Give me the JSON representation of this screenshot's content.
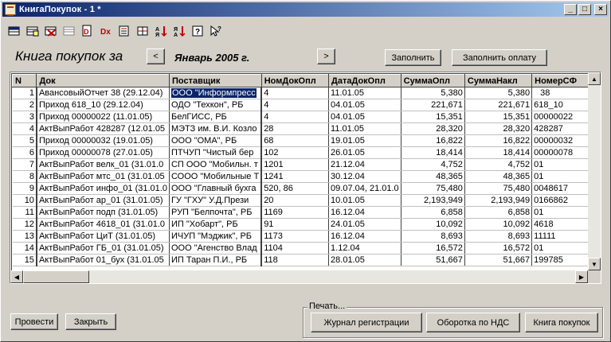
{
  "window": {
    "title": "КнигаПокупок - 1 *",
    "controls": [
      "_",
      "□",
      "×"
    ]
  },
  "toolbar": {
    "icons": [
      "new-row-icon",
      "copy-row-icon",
      "delete-row-icon",
      "edit-row-icon",
      "add-doc-icon",
      "remove-doc-icon",
      "report-icon",
      "table-icon",
      "sort-asc-icon",
      "sort-desc-icon",
      "help-icon",
      "cursor-help-icon"
    ]
  },
  "header": {
    "title": "Книга покупок за",
    "period": "Январь 2005 г.",
    "prev_label": "<",
    "next_label": ">",
    "fill_label": "Заполнить",
    "fill_payment_label": "Заполнить оплату"
  },
  "table": {
    "columns": [
      "N",
      "Док",
      "Поставщик",
      "НомДокОпл",
      "ДатаДокОпл",
      "СуммаОпл",
      "СуммаНакл",
      "НомерСФ"
    ],
    "rows": [
      [
        "1",
        "АвансовыйОтчет 38 (29.12.04)",
        "ООО \"Информпресс",
        "4",
        "11.01.05",
        "5,380",
        "5,380",
        "38"
      ],
      [
        "2",
        "Приход 618_10 (29.12.04)",
        "ОДО \"Техкон\", РБ",
        "4",
        "04.01.05",
        "221,671",
        "221,671",
        "618_10"
      ],
      [
        "3",
        "Приход 00000022 (11.01.05)",
        "БелГИСС, РБ",
        "4",
        "04.01.05",
        "15,351",
        "15,351",
        "00000022"
      ],
      [
        "4",
        "АктВыпРабот 428287 (12.01.05",
        "МЭТЗ им. В.И. Козло",
        "28",
        "11.01.05",
        "28,320",
        "28,320",
        "428287"
      ],
      [
        "5",
        "Приход 00000032 (19.01.05)",
        "ООО \"ОМА\", РБ",
        "68",
        "19.01.05",
        "16,822",
        "16,822",
        "00000032"
      ],
      [
        "6",
        "Приход 00000078 (27.01.05)",
        "ПТЧУП \"Чистый бер",
        "102",
        "26.01.05",
        "18,414",
        "18,414",
        "00000078"
      ],
      [
        "7",
        "АктВыпРабот велк_01 (31.01.0",
        "СП ООО \"Мобильн. т",
        "1201",
        "21.12.04",
        "4,752",
        "4,752",
        "01"
      ],
      [
        "8",
        "АктВыпРабот мтс_01 (31.01.05",
        "СООО \"Мобильные Т",
        "1241",
        "30.12.04",
        "48,365",
        "48,365",
        "01"
      ],
      [
        "9",
        "АктВыпРабот инфо_01 (31.01.0",
        "ООО \"Главный бухга",
        "520, 86",
        "09.07.04, 21.01.0",
        "75,480",
        "75,480",
        "0048617"
      ],
      [
        "10",
        "АктВыпРабот ар_01 (31.01.05)",
        "ГУ \"ГХУ\" У.Д.Прези",
        "20",
        "10.01.05",
        "2,193,949",
        "2,193,949",
        "0166862"
      ],
      [
        "11",
        "АктВыпРабот подп (31.01.05)",
        "РУП \"Белпочта\", РБ",
        "1169",
        "16.12.04",
        "6,858",
        "6,858",
        "01"
      ],
      [
        "12",
        "АктВыпРабот 4618_01 (31.01.0",
        "ИП \"Хобарт\", РБ",
        "91",
        "24.01.05",
        "10,092",
        "10,092",
        "4618"
      ],
      [
        "13",
        "АктВыпРабот ЦиТ (31.01.05)",
        "ИЧУП \"Мэджик\", РБ",
        "1173",
        "16.12.04",
        "8,693",
        "8,693",
        "11111"
      ],
      [
        "14",
        "АктВыпРабот ГБ_01 (31.01.05)",
        "ООО \"Агенство Влад",
        "1104",
        "1.12.04",
        "16,572",
        "16,572",
        "01"
      ],
      [
        "15",
        "АктВыпРабот 01_бух (31.01.05",
        "ИП Таран П.И., РБ",
        "118",
        "28.01.05",
        "51,667",
        "51,667",
        "199785"
      ]
    ],
    "selected_row": 1,
    "selected_column": "Поставщик"
  },
  "footer": {
    "post_label": "Провести",
    "close_label": "Закрыть",
    "print_group_label": "Печать...",
    "journal_label": "Журнал регистрации",
    "vat_turnover_label": "Оборотка по НДС",
    "purchase_book_label": "Книга покупок"
  }
}
